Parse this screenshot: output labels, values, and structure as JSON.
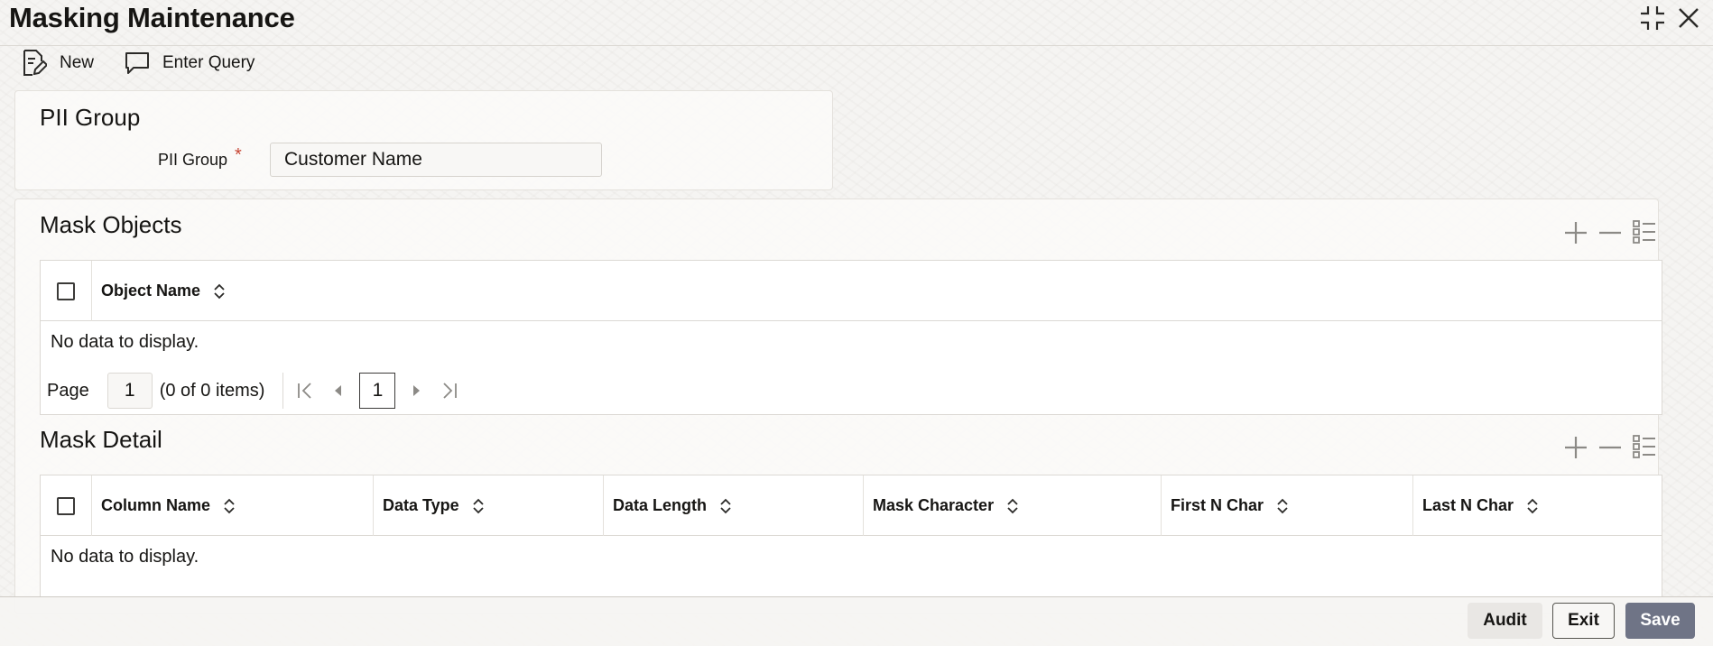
{
  "window": {
    "title": "Masking Maintenance"
  },
  "toolbar": {
    "new_label": "New",
    "enter_query_label": "Enter Query"
  },
  "pii_group": {
    "section_title": "PII Group",
    "field_label": "PII Group",
    "required_mark": "*",
    "field_value": "Customer Name"
  },
  "mask_objects": {
    "section_title": "Mask Objects",
    "columns": [
      "Object Name"
    ],
    "empty_text": "No data to display.",
    "pager": {
      "page_label": "Page",
      "page_value": "1",
      "items_text": "(0 of 0 items)",
      "current_page": "1"
    }
  },
  "mask_detail": {
    "section_title": "Mask Detail",
    "columns": [
      "Column Name",
      "Data Type",
      "Data Length",
      "Mask Character",
      "First N Char",
      "Last N Char"
    ],
    "empty_text": "No data to display."
  },
  "footer": {
    "audit_label": "Audit",
    "exit_label": "Exit",
    "save_label": "Save"
  },
  "colors": {
    "required": "#c74634",
    "save_button": "#6f7486",
    "text": "#161513"
  },
  "icons": {
    "new": "document-edit-icon",
    "enter_query": "speech-bubble-icon",
    "minimize": "collapse-icon",
    "close": "close-icon",
    "add": "plus-icon",
    "remove": "minus-icon",
    "settings": "list-settings-icon",
    "sort": "sort-icon"
  }
}
